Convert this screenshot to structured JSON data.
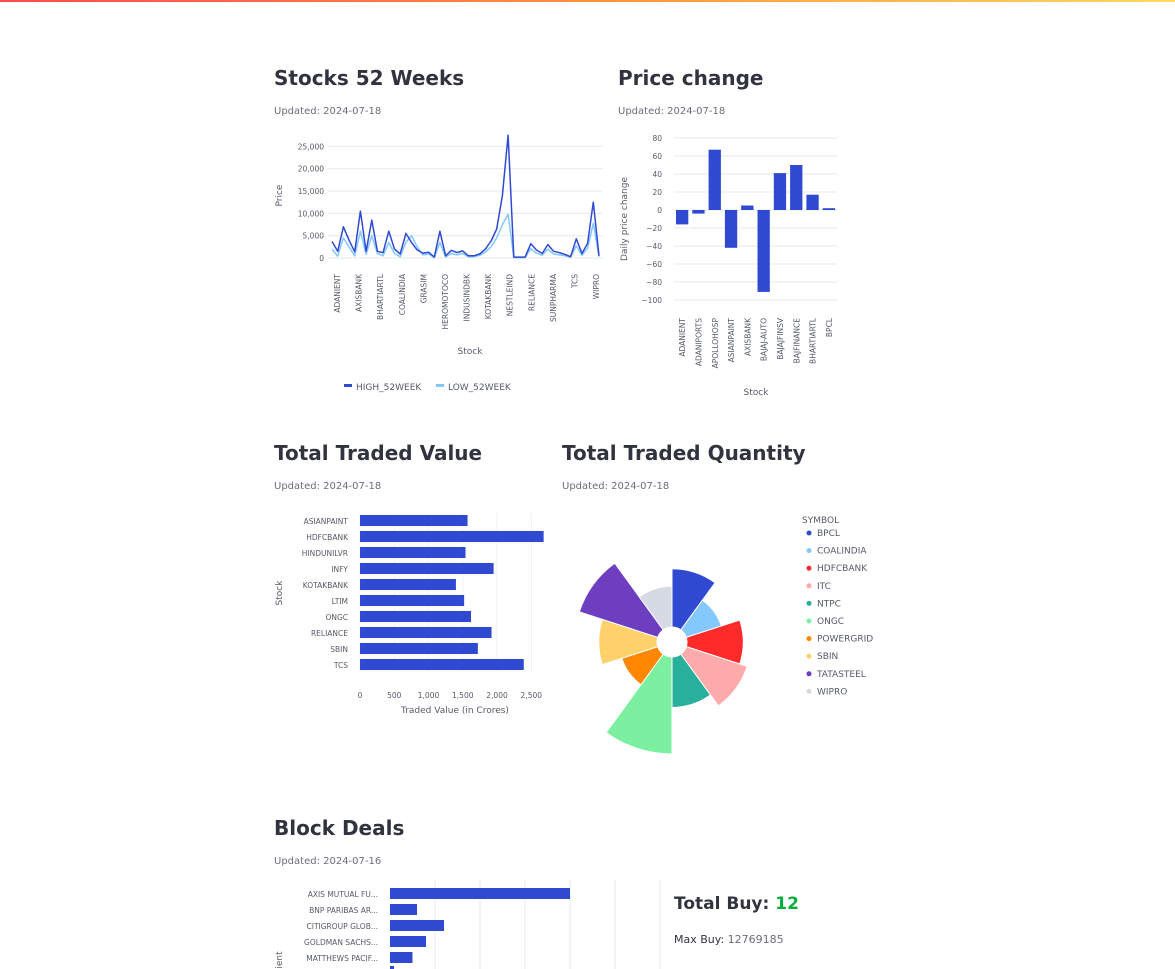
{
  "colors": {
    "primary": "#3049d1",
    "light": "#83c9ff",
    "positive": "#09ab3b"
  },
  "stocks52": {
    "title": "Stocks 52 Weeks",
    "updated": "Updated: 2024-07-18",
    "chart_data": {
      "type": "line",
      "xlabel": "Stock",
      "ylabel": "Price",
      "ylim": [
        0,
        28000
      ],
      "yticks": [
        0,
        5000,
        10000,
        15000,
        20000,
        25000
      ],
      "ytick_labels": [
        "0",
        "5,000",
        "10,000",
        "15,000",
        "20,000",
        "25,000"
      ],
      "x_tick_labels": [
        "ADANIENT",
        "AXISBANK",
        "BHARTIARTL",
        "COALINDIA",
        "GRASIM",
        "HEROMOTOCO",
        "INDUSINDBK",
        "KOTAKBANK",
        "NESTLEIND",
        "RELIANCE",
        "SUNPHARMA",
        "TCS",
        "WIPRO"
      ],
      "legend": "bottom",
      "series": [
        {
          "name": "HIGH_52WEEK",
          "color": "#3049d1",
          "values": [
            3700,
            1500,
            7000,
            4000,
            1400,
            10500,
            1500,
            8500,
            1500,
            1200,
            6000,
            2000,
            900,
            5500,
            3500,
            1800,
            1100,
            1300,
            200,
            6000,
            500,
            1700,
            1200,
            1600,
            500,
            500,
            900,
            2000,
            3800,
            6500,
            14000,
            27500,
            200,
            200,
            200,
            3200,
            1800,
            1000,
            3000,
            1500,
            1200,
            800,
            300,
            4300,
            1000,
            3300,
            12500,
            500
          ]
        },
        {
          "name": "LOW_52WEEK",
          "color": "#83c9ff",
          "values": [
            2000,
            400,
            4500,
            2500,
            500,
            6000,
            800,
            5000,
            1000,
            500,
            3500,
            1000,
            300,
            3500,
            5000,
            2500,
            700,
            900,
            100,
            3500,
            200,
            1000,
            700,
            1000,
            300,
            300,
            600,
            1300,
            2500,
            4500,
            7500,
            9800,
            100,
            100,
            100,
            2100,
            1100,
            600,
            2000,
            900,
            700,
            500,
            200,
            2700,
            600,
            2200,
            7800,
            300
          ]
        }
      ]
    }
  },
  "price_change": {
    "title": "Price change",
    "updated": "Updated: 2024-07-18",
    "chart_data": {
      "type": "bar",
      "xlabel": "Stock",
      "ylabel": "Daily price change",
      "ylim": [
        -100,
        80
      ],
      "yticks": [
        80,
        60,
        40,
        20,
        0,
        -20,
        -40,
        -60,
        -80,
        -100
      ],
      "ytick_labels": [
        "80",
        "60",
        "40",
        "20",
        "0",
        "−20",
        "−40",
        "−60",
        "−80",
        "−100"
      ],
      "categories": [
        "ADANIENT",
        "ADANIPORTS",
        "APOLLOHOSP",
        "ASIANPAINT",
        "AXISBANK",
        "BAJAJ-AUTO",
        "BAJAJFINSV",
        "BAJFINANCE",
        "BHARTIARTL",
        "BPCL"
      ],
      "values": [
        -16,
        -4,
        67,
        -42,
        5,
        -91,
        41,
        50,
        17,
        2
      ]
    }
  },
  "traded_value": {
    "title": "Total Traded Value",
    "updated": "Updated: 2024-07-18",
    "chart_data": {
      "type": "bar",
      "orientation": "horizontal",
      "xlabel": "Traded Value (in Crores)",
      "ylabel": "Stock",
      "xlim": [
        0,
        2700
      ],
      "xticks": [
        0,
        500,
        1000,
        1500,
        2000,
        2500
      ],
      "xtick_labels": [
        "0",
        "500",
        "1,000",
        "1,500",
        "2,000",
        "2,500"
      ],
      "categories": [
        "ASIANPAINT",
        "HDFCBANK",
        "HINDUNILVR",
        "INFY",
        "KOTAKBANK",
        "LTIM",
        "ONGC",
        "RELIANCE",
        "SBIN",
        "TCS"
      ],
      "values": [
        1570,
        2680,
        1540,
        1950,
        1400,
        1520,
        1620,
        1920,
        1720,
        2390
      ]
    }
  },
  "traded_qty": {
    "title": "Total Traded Quantity",
    "updated": "Updated: 2024-07-18",
    "chart_data": {
      "type": "pie",
      "subtype": "barpolar",
      "legend_title": "SYMBOL",
      "legend": "right",
      "categories": [
        "BPCL",
        "COALINDIA",
        "HDFCBANK",
        "ITC",
        "NTPC",
        "ONGC",
        "POWERGRID",
        "SBIN",
        "TATASTEEL",
        "WIPRO"
      ],
      "values": [
        60,
        38,
        58,
        66,
        52,
        100,
        39,
        60,
        85,
        42
      ],
      "colors": [
        "#3049d1",
        "#83c9ff",
        "#ff2b2b",
        "#ffabab",
        "#29b09d",
        "#7defa1",
        "#ff8700",
        "#ffd16a",
        "#6d3fc0",
        "#d5dae5"
      ]
    }
  },
  "block_deals": {
    "title": "Block Deals",
    "updated": "Updated: 2024-07-16",
    "chart_data": {
      "type": "bar",
      "orientation": "horizontal",
      "ylabel": "ient",
      "categories": [
        "AXIS MUTUAL FU...",
        "BNP PARIBAS AR...",
        "CITIGROUP GLOB...",
        "GOLDMAN SACHS...",
        "MATTHEWS PACIF..."
      ],
      "values": [
        40,
        6,
        12,
        8,
        5
      ]
    },
    "total_buy_label": "Total Buy: ",
    "total_buy_value": "12",
    "max_buy_label": "Max Buy: ",
    "max_buy_value": "12769185"
  }
}
